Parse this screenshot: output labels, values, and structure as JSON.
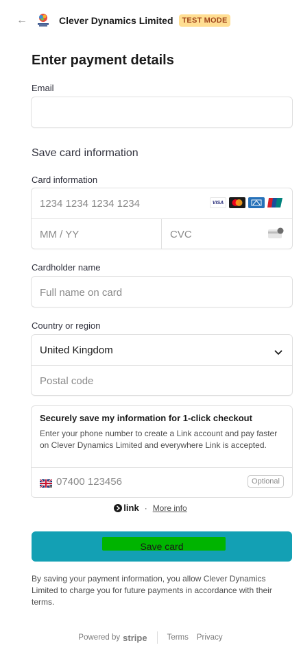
{
  "header": {
    "merchant": "Clever Dynamics Limited",
    "badge": "TEST MODE"
  },
  "title": "Enter payment details",
  "email": {
    "label": "Email",
    "value": ""
  },
  "section_title": "Save card information",
  "card": {
    "label": "Card information",
    "number_placeholder": "1234 1234 1234 1234",
    "expiry_placeholder": "MM / YY",
    "cvc_placeholder": "CVC",
    "brands": [
      "VISA",
      "mastercard",
      "amex",
      "unionpay"
    ]
  },
  "cardholder": {
    "label": "Cardholder name",
    "placeholder": "Full name on card"
  },
  "country": {
    "label": "Country or region",
    "value": "United Kingdom",
    "postal_placeholder": "Postal code"
  },
  "link": {
    "title": "Securely save my information for 1-click checkout",
    "description": "Enter your phone number to create a Link account and pay faster on Clever Dynamics Limited and everywhere Link is accepted.",
    "phone_placeholder": "07400 123456",
    "optional": "Optional"
  },
  "link_row": {
    "logo": "link",
    "dot": "·",
    "more_info": "More info"
  },
  "save_button": "Save card",
  "terms": "By saving your payment information, you allow Clever Dynamics Limited to charge you for future payments in accordance with their terms.",
  "footer": {
    "powered_by": "Powered by",
    "stripe": "stripe",
    "terms": "Terms",
    "privacy": "Privacy"
  },
  "colors": {
    "button": "#13a0b4",
    "badge_bg": "#ffde92",
    "badge_text": "#a0451b",
    "highlight": "#00b400"
  }
}
